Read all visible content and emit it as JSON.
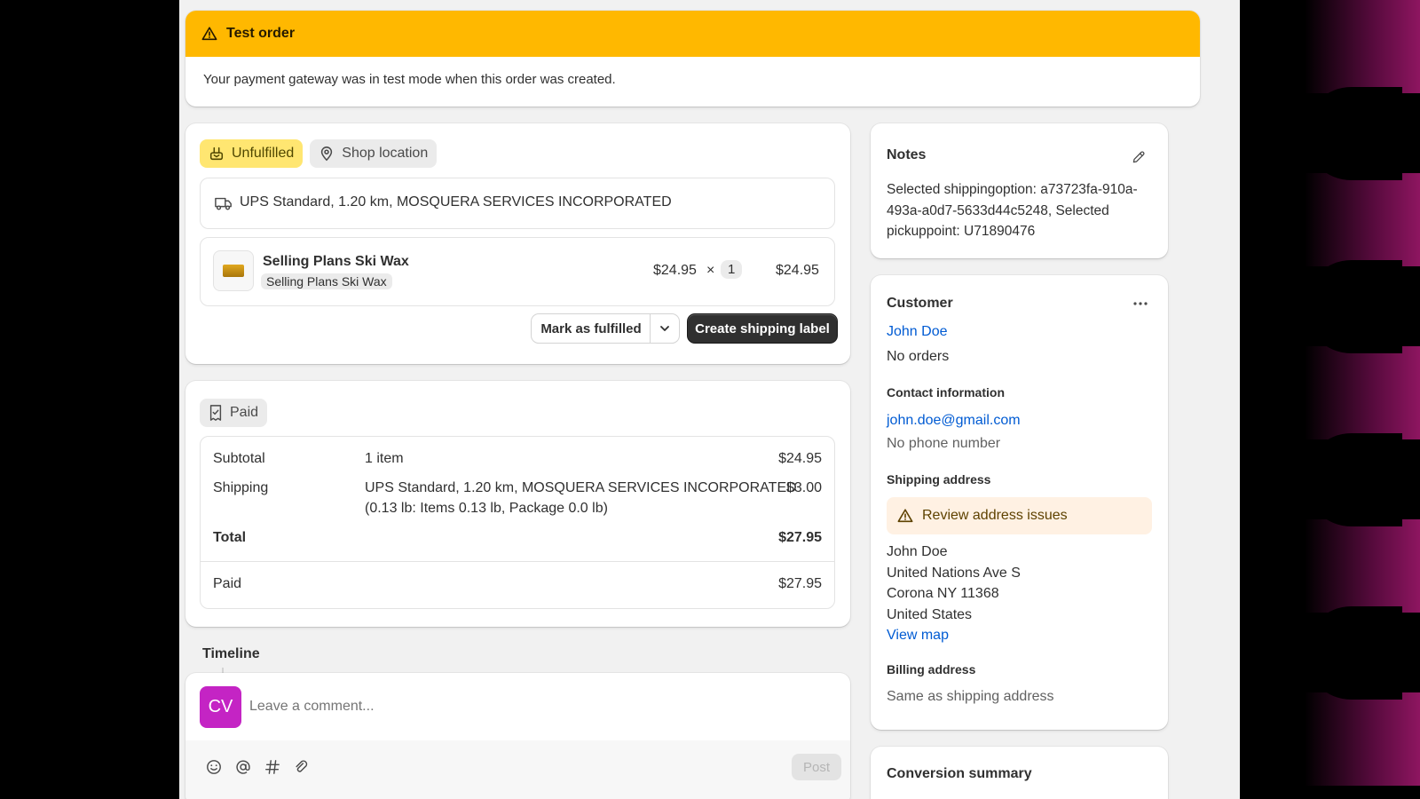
{
  "banner": {
    "title": "Test order",
    "message": "Your payment gateway was in test mode when this order was created."
  },
  "fulfillment": {
    "status": "Unfulfilled",
    "location": "Shop location",
    "shipping_method": "UPS Standard, 1.20 km, MOSQUERA SERVICES INCORPORATED",
    "item": {
      "name": "Selling Plans Ski Wax",
      "variant": "Selling Plans Ski Wax",
      "price": "$24.95",
      "times": "×",
      "quantity": "1",
      "total": "$24.95"
    },
    "mark_fulfilled_label": "Mark as fulfilled",
    "create_label_label": "Create shipping label"
  },
  "payment": {
    "status": "Paid",
    "rows": {
      "subtotal": {
        "label": "Subtotal",
        "desc": "1 item",
        "amount": "$24.95"
      },
      "shipping": {
        "label": "Shipping",
        "desc": "UPS Standard, 1.20 km, MOSQUERA SERVICES INCORPORATED",
        "desc2": "(0.13 lb: Items 0.13 lb, Package 0.0 lb)",
        "amount": "$3.00"
      },
      "total": {
        "label": "Total",
        "amount": "$27.95"
      },
      "paid": {
        "label": "Paid",
        "amount": "$27.95"
      }
    }
  },
  "timeline": {
    "title": "Timeline",
    "avatar_initials": "CV",
    "comment_placeholder": "Leave a comment...",
    "post_label": "Post"
  },
  "notes": {
    "title": "Notes",
    "text": "Selected shippingoption: a73723fa-910a-493a-a0d7-5633d44c5248, Selected pickuppoint: U71890476"
  },
  "customer": {
    "title": "Customer",
    "name": "John Doe",
    "orders": "No orders",
    "contact_title": "Contact information",
    "email": "john.doe@gmail.com",
    "phone": "No phone number",
    "shipping_title": "Shipping address",
    "address_warning": "Review address issues",
    "address_lines": [
      "John Doe",
      "United Nations Ave S",
      "Corona NY 11368",
      "United States"
    ],
    "view_map": "View map",
    "billing_title": "Billing address",
    "billing_text": "Same as shipping address"
  },
  "conversion": {
    "title": "Conversion summary"
  },
  "colors": {
    "banner": "#ffb800",
    "unfulfilled_badge": "#ffe671",
    "avatar": "#c424c4",
    "link": "#005bd3",
    "primary_button": "#303030"
  }
}
